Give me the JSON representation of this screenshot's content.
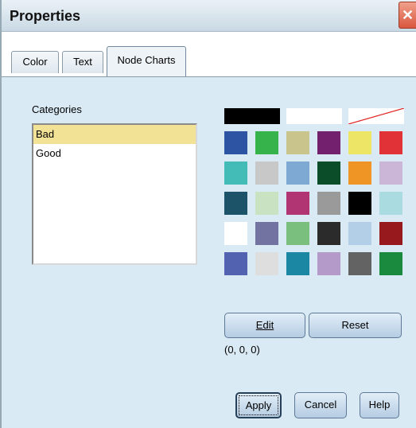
{
  "window": {
    "title": "Properties",
    "close_glyph": "✕"
  },
  "tabs": [
    {
      "label": "Color"
    },
    {
      "label": "Text"
    },
    {
      "label": "Node Charts",
      "active": true
    }
  ],
  "categories": {
    "label": "Categories",
    "items": [
      {
        "label": "Bad",
        "selected": true
      },
      {
        "label": "Good",
        "selected": false
      }
    ]
  },
  "palette": {
    "top_strip": [
      "#000000",
      "#ffffff",
      "none"
    ],
    "rows": [
      [
        "#2d54a2",
        "#36b34a",
        "#c9c38c",
        "#73216f",
        "#ece566",
        "#e13238"
      ],
      [
        "#43bcb7",
        "#c8c8c8",
        "#7ea9d2",
        "#0b4d29",
        "#ef9526",
        "#cbb6d8"
      ],
      [
        "#1c5368",
        "#c9e2c2",
        "#b13572",
        "#9a9a9a",
        "#000000",
        "#a9dbe0"
      ],
      [
        "#ffffff",
        "#7273a0",
        "#7bbf7f",
        "#2b2b2b",
        "#b2cfe7",
        "#98191d"
      ],
      [
        "#5262b1",
        "#dedede",
        "#1c87a3",
        "#b49ac8",
        "#636363",
        "#1a8b3e"
      ]
    ]
  },
  "buttons": {
    "edit": "Edit",
    "reset": "Reset",
    "apply": "Apply",
    "cancel": "Cancel",
    "help": "Help"
  },
  "rgb_value": "(0, 0, 0)"
}
